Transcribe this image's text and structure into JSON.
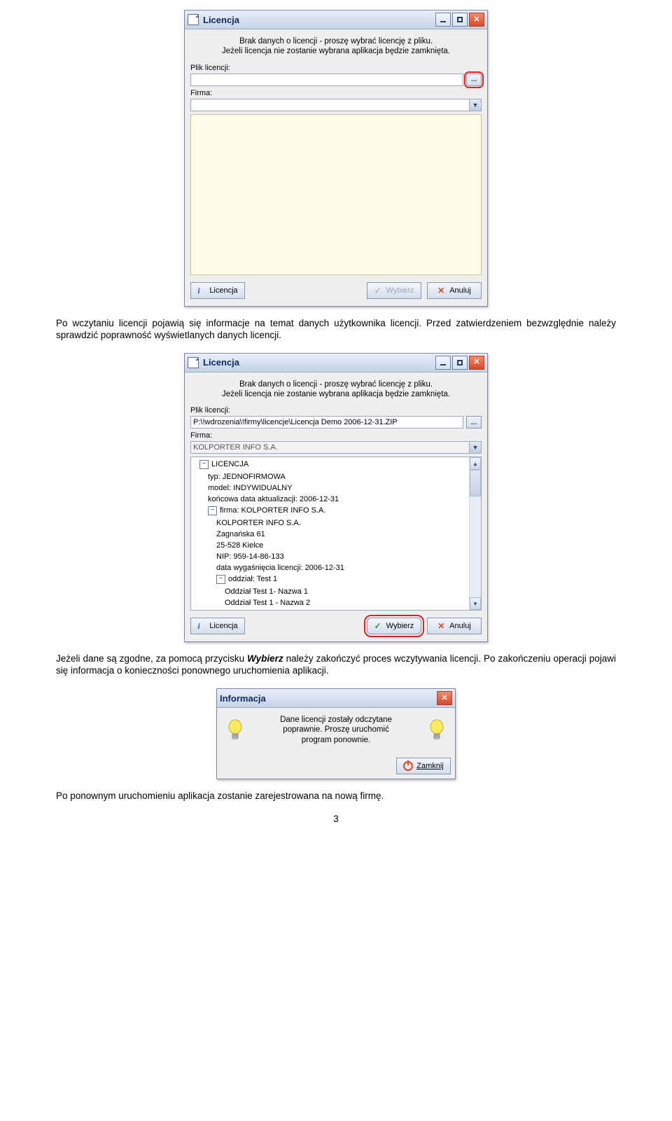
{
  "win1": {
    "title": "Licencja",
    "msg1": "Brak danych o licencji - proszę wybrać licencję z pliku.",
    "msg2": "Jeżeli licencja nie zostanie wybrana aplikacja będzie zamknięta.",
    "file_label": "Plik licencji:",
    "file_value": "",
    "company_label": "Firma:",
    "company_value": "",
    "btn_licencja": "Licencja",
    "btn_wybierz": "Wybierz",
    "btn_anuluj": "Anuluj",
    "browse": "..."
  },
  "para1_pre": "Po wczytaniu licencji pojawią się informacje na temat danych użytkownika licencji. Przed zatwierdzeniem bezwzględnie należy sprawdzić poprawność wyświetlanych danych licencji.",
  "win2": {
    "title": "Licencja",
    "msg1": "Brak danych o licencji - proszę wybrać licencję z pliku.",
    "msg2": "Jeżeli licencja nie zostanie wybrana aplikacja będzie zamknięta.",
    "file_label": "Plik licencji:",
    "file_value": "P:\\!wdrozenia\\!firmy\\licencje\\Licencja Demo 2006-12-31.ZIP",
    "company_label": "Firma:",
    "company_value": "KOLPORTER INFO S.A.",
    "tree": {
      "root": "LICENCJA",
      "typ": "typ:   JEDNOFIRMOWA",
      "model": "model:   INDYWIDUALNY",
      "konc": "końcowa data aktualizacji:   2006-12-31",
      "firma_label": "firma:   KOLPORTER INFO S.A.",
      "firma_name": "KOLPORTER INFO S.A.",
      "addr1": "Zagnańska 61",
      "addr2": "25-528 Kielce",
      "nip": "NIP:   959-14-86-133",
      "wyga": "data wygaśnięcia licencji:   2006-12-31",
      "oddzial_label": "oddział:   Test 1",
      "odd1": "Oddział Test 1- Nazwa 1",
      "odd2": "Oddział Test 1 - Nazwa 2"
    },
    "btn_licencja": "Licencja",
    "btn_wybierz": "Wybierz",
    "btn_anuluj": "Anuluj",
    "browse": "..."
  },
  "para2_a": "Jeżeli dane są zgodne, za pomocą przycisku ",
  "para2_btn": "Wybierz",
  "para2_b": " należy zakończyć proces wczytywania licencji. Po zakończeniu operacji pojawi się informacja o konieczności ponownego uruchomienia aplikacji.",
  "infodlg": {
    "title": "Informacja",
    "msg1": "Dane licencji zostały odczytane",
    "msg2": "poprawnie. Proszę uruchomić",
    "msg3": "program ponownie.",
    "btn": "Zamknij"
  },
  "para3": "Po ponownym uruchomieniu aplikacja zostanie zarejestrowana na nową firmę.",
  "pagenum": "3"
}
